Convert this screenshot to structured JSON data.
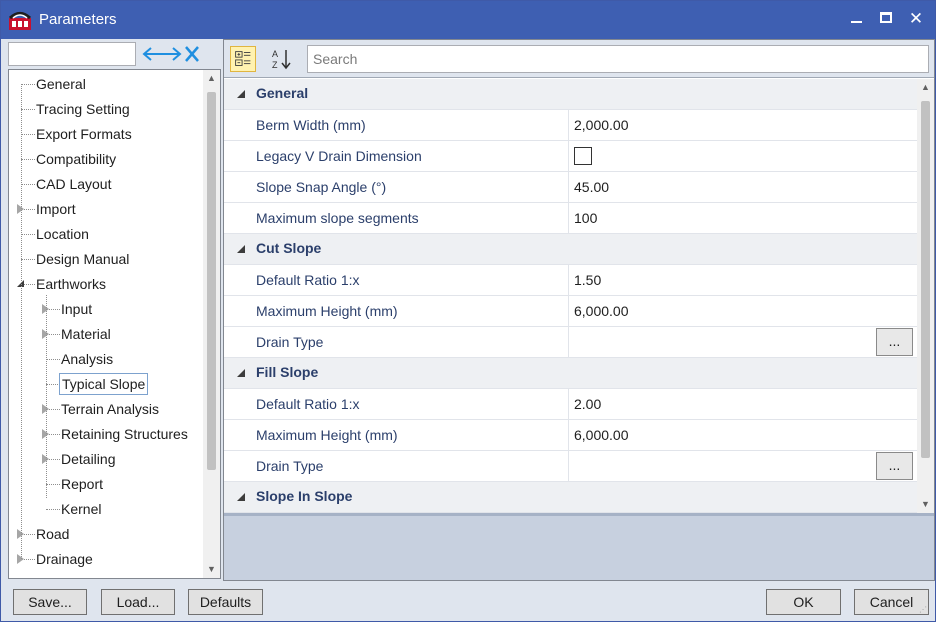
{
  "window": {
    "title": "Parameters",
    "minimize_icon": "minimize-icon",
    "maximize_icon": "maximize-icon",
    "close_icon": "close-icon",
    "title_color": "#3e5fb2"
  },
  "filter": {
    "value": "",
    "clear_icon": "clear-filter-icon"
  },
  "tree": {
    "items": [
      {
        "label": "General",
        "level": 0,
        "state": "leaf"
      },
      {
        "label": "Tracing Setting",
        "level": 0,
        "state": "leaf"
      },
      {
        "label": "Export Formats",
        "level": 0,
        "state": "leaf"
      },
      {
        "label": "Compatibility",
        "level": 0,
        "state": "leaf"
      },
      {
        "label": "CAD Layout",
        "level": 0,
        "state": "leaf"
      },
      {
        "label": "Import",
        "level": 0,
        "state": "collapsed"
      },
      {
        "label": "Location",
        "level": 0,
        "state": "leaf"
      },
      {
        "label": "Design Manual",
        "level": 0,
        "state": "leaf"
      },
      {
        "label": "Earthworks",
        "level": 0,
        "state": "expanded"
      },
      {
        "label": "Input",
        "level": 1,
        "state": "collapsed"
      },
      {
        "label": "Material",
        "level": 1,
        "state": "collapsed"
      },
      {
        "label": "Analysis",
        "level": 1,
        "state": "leaf"
      },
      {
        "label": "Typical Slope",
        "level": 1,
        "state": "leaf",
        "selected": true
      },
      {
        "label": "Terrain Analysis",
        "level": 1,
        "state": "collapsed"
      },
      {
        "label": "Retaining Structures",
        "level": 1,
        "state": "collapsed"
      },
      {
        "label": "Detailing",
        "level": 1,
        "state": "collapsed"
      },
      {
        "label": "Report",
        "level": 1,
        "state": "leaf"
      },
      {
        "label": "Kernel",
        "level": 1,
        "state": "leaf"
      },
      {
        "label": "Road",
        "level": 0,
        "state": "collapsed"
      },
      {
        "label": "Drainage",
        "level": 0,
        "state": "collapsed"
      }
    ]
  },
  "toolbar": {
    "categorized_icon": "categorized-view-icon",
    "sort_icon": "alphabetical-sort-icon",
    "search_placeholder": "Search"
  },
  "grid": {
    "rows": [
      {
        "type": "category",
        "label": "General"
      },
      {
        "type": "prop",
        "name": "Berm Width (mm)",
        "value": "2,000.00"
      },
      {
        "type": "prop",
        "name": "Legacy V Drain Dimension",
        "value": "",
        "checkbox": true
      },
      {
        "type": "prop",
        "name": "Slope Snap Angle (°)",
        "value": "45.00"
      },
      {
        "type": "prop",
        "name": "Maximum slope segments",
        "value": "100"
      },
      {
        "type": "category",
        "label": "Cut Slope"
      },
      {
        "type": "prop",
        "name": "Default Ratio 1:x",
        "value": "1.50"
      },
      {
        "type": "prop",
        "name": "Maximum Height (mm)",
        "value": "6,000.00"
      },
      {
        "type": "prop",
        "name": "Drain Type",
        "value": "",
        "button": "..."
      },
      {
        "type": "category",
        "label": "Fill Slope"
      },
      {
        "type": "prop",
        "name": "Default Ratio 1:x",
        "value": "2.00"
      },
      {
        "type": "prop",
        "name": "Maximum Height (mm)",
        "value": "6,000.00"
      },
      {
        "type": "prop",
        "name": "Drain Type",
        "value": "",
        "button": "..."
      },
      {
        "type": "category",
        "label": "Slope In Slope"
      }
    ]
  },
  "buttons": {
    "save": "Save...",
    "load": "Load...",
    "defaults": "Defaults",
    "ok": "OK",
    "cancel": "Cancel"
  }
}
